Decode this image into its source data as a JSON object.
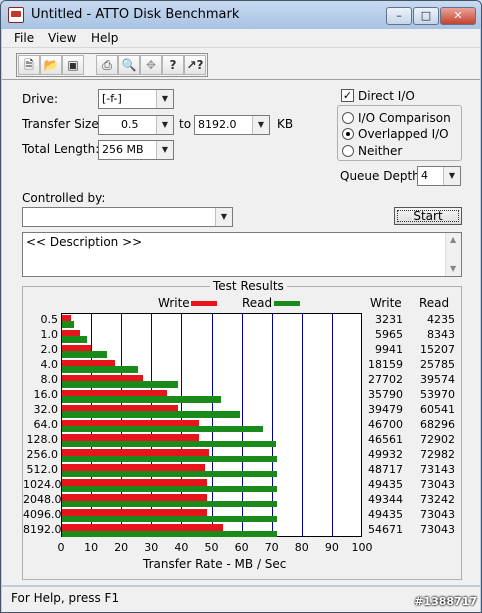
{
  "window": {
    "title": "Untitled - ATTO Disk Benchmark",
    "min": "–",
    "max": "□",
    "close": "✕"
  },
  "menu": [
    "File",
    "View",
    "Help"
  ],
  "toolbar": [
    "new-icon",
    "open-icon",
    "save-icon",
    "print-icon",
    "print-preview-icon",
    "move-icon",
    "help-icon",
    "context-help-icon"
  ],
  "form": {
    "drive_label": "Drive:",
    "drive_value": "[-f-]",
    "transfer_label": "Transfer Size:",
    "transfer_from": "0.5",
    "to_label": "to",
    "transfer_to": "8192.0",
    "kb_label": "KB",
    "length_label": "Total Length:",
    "length_value": "256 MB",
    "controlled_label": "Controlled by:",
    "controlled_value": "",
    "direct_io_label": "Direct I/O",
    "direct_io_checked": true,
    "io_comparison_label": "I/O Comparison",
    "overlapped_label": "Overlapped I/O",
    "neither_label": "Neither",
    "queue_label": "Queue Depth:",
    "queue_value": "4",
    "start_label": "Start",
    "description": "<< Description >>"
  },
  "chart_data": {
    "type": "bar",
    "title": "Test Results",
    "xlabel": "Transfer Rate - MB / Sec",
    "xlim": [
      0,
      100
    ],
    "xticks": [
      "0",
      "10",
      "20",
      "30",
      "40",
      "50",
      "60",
      "70",
      "80",
      "90",
      "100"
    ],
    "categories": [
      "0.5",
      "1.0",
      "2.0",
      "4.0",
      "8.0",
      "16.0",
      "32.0",
      "64.0",
      "128.0",
      "256.0",
      "512.0",
      "1024.0",
      "2048.0",
      "4096.0",
      "8192.0"
    ],
    "legend_write": "Write",
    "legend_read": "Read",
    "col_write": "Write",
    "col_read": "Read",
    "write_color": "#e8141b",
    "read_color": "#1a8a1a",
    "series": [
      {
        "name": "Write",
        "values": [
          3231,
          5965,
          9941,
          18159,
          27702,
          35790,
          39479,
          46700,
          46561,
          49932,
          48717,
          49435,
          49344,
          49435,
          54671
        ]
      },
      {
        "name": "Read",
        "values": [
          4235,
          8343,
          15207,
          25785,
          39574,
          53970,
          60541,
          68296,
          72902,
          72982,
          73143,
          73043,
          73242,
          73043,
          73043
        ]
      }
    ]
  },
  "status": "For Help, press F1",
  "watermark": "#1388717"
}
